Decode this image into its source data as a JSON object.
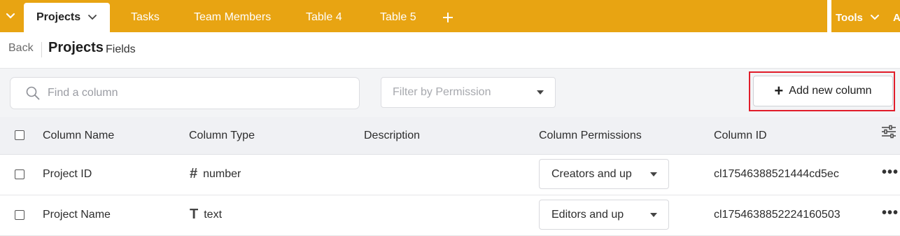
{
  "tabs": [
    {
      "label": "Projects",
      "active": true
    },
    {
      "label": "Tasks"
    },
    {
      "label": "Team Members"
    },
    {
      "label": "Table 4"
    },
    {
      "label": "Table 5"
    }
  ],
  "add_tab_icon": "plus-icon",
  "tools": {
    "label": "Tools",
    "extra": "A"
  },
  "header": {
    "back": "Back",
    "title": "Projects",
    "subtitle": "Fields"
  },
  "search": {
    "placeholder": "Find a column"
  },
  "filter": {
    "placeholder": "Filter by Permission"
  },
  "add_column": {
    "label": "Add new column"
  },
  "table": {
    "columns": [
      "Column Name",
      "Column Type",
      "Description",
      "Column Permissions",
      "Column ID"
    ],
    "rows": [
      {
        "name": "Project ID",
        "type_icon": "#",
        "type": "number",
        "description": "",
        "permission": "Creators and up",
        "id": "cl17546388521444cd5ec"
      },
      {
        "name": "Project Name",
        "type_icon": "T",
        "type": "text",
        "description": "",
        "permission": "Editors and up",
        "id": "cl1754638852224160503"
      }
    ]
  },
  "colors": {
    "accent": "#e8a412",
    "highlight": "#e11d2a"
  }
}
